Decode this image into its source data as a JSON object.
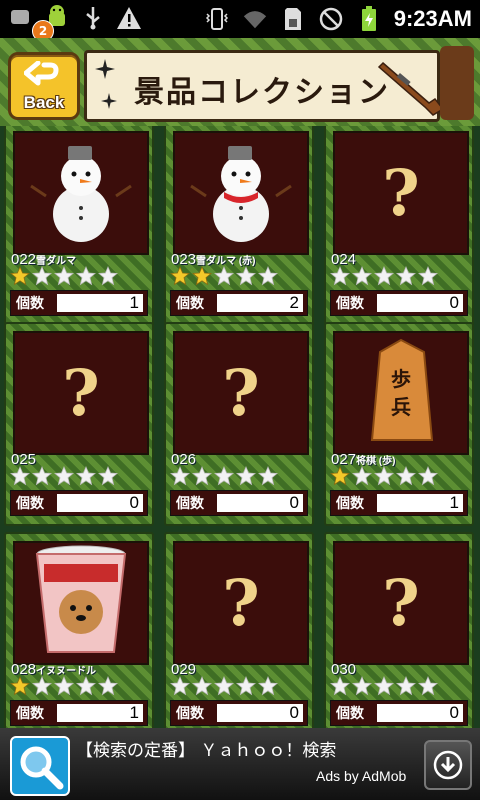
{
  "status_bar": {
    "notification_count": "2",
    "time": "9:23AM",
    "icons": [
      "notification-icon",
      "android-icon",
      "usb-icon",
      "warning-icon",
      "vibrate-icon",
      "wifi-icon",
      "sd-card-icon",
      "no-signal-icon",
      "battery-charging-icon"
    ]
  },
  "header": {
    "back_label": "Back",
    "title": "景品コレクション"
  },
  "count_label": "個数",
  "items": [
    {
      "num": "022",
      "name": "雪ダルマ",
      "stars": 1,
      "count": "1",
      "image": "snowman-icon",
      "unlocked": true
    },
    {
      "num": "023",
      "name": "雪ダルマ (赤)",
      "stars": 2,
      "count": "2",
      "image": "snowman-red-scarf-icon",
      "unlocked": true
    },
    {
      "num": "024",
      "name": "",
      "stars": 0,
      "count": "0",
      "image": "question-mark-icon",
      "unlocked": false
    },
    {
      "num": "025",
      "name": "",
      "stars": 0,
      "count": "0",
      "image": "question-mark-icon",
      "unlocked": false
    },
    {
      "num": "026",
      "name": "",
      "stars": 0,
      "count": "0",
      "image": "question-mark-icon",
      "unlocked": false
    },
    {
      "num": "027",
      "name": "将棋 (歩)",
      "stars": 1,
      "count": "1",
      "image": "shogi-piece-icon",
      "unlocked": true
    },
    {
      "num": "028",
      "name": "イヌヌードル",
      "stars": 1,
      "count": "1",
      "image": "cup-noodle-icon",
      "unlocked": true
    },
    {
      "num": "029",
      "name": "",
      "stars": 0,
      "count": "0",
      "image": "question-mark-icon",
      "unlocked": false
    },
    {
      "num": "030",
      "name": "",
      "stars": 0,
      "count": "0",
      "image": "question-mark-icon",
      "unlocked": false
    }
  ],
  "question_mark": "?",
  "shogi_text": "歩兵",
  "ad": {
    "text": "【検索の定番】 Ｙａｈｏｏ！検索",
    "attribution": "Ads by AdMob"
  },
  "colors": {
    "card_dark": "#3b0d0b",
    "star_gold": "#f4c92a",
    "star_empty": "#f2f2f2",
    "back_yellow": "#f4c32a"
  }
}
